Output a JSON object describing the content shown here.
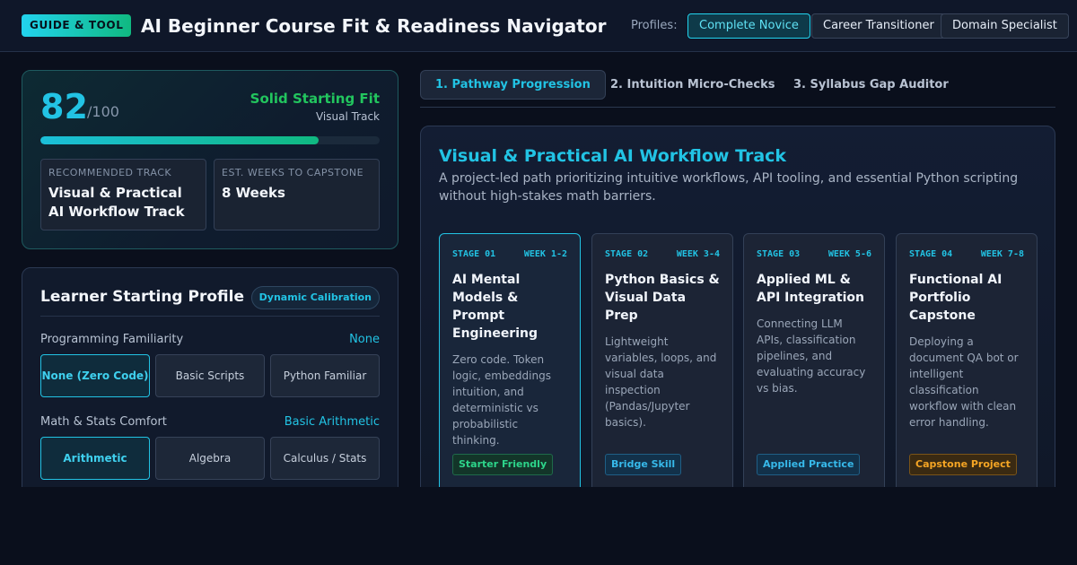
{
  "header": {
    "badge": "GUIDE & TOOL",
    "title": "AI Beginner Course Fit & Readiness Navigator",
    "profiles_label": "Profiles:",
    "profiles": [
      {
        "label": "Complete Novice",
        "active": true
      },
      {
        "label": "Career Transitioner",
        "active": false
      },
      {
        "label": "Domain Specialist",
        "active": false
      }
    ]
  },
  "score": {
    "value": "82",
    "max": "/100",
    "fit_label": "Solid Starting Fit",
    "track_sub": "Visual Track",
    "progress_percent": 82,
    "recommended_label": "RECOMMENDED TRACK",
    "recommended_value": "Visual & Practical AI Workflow Track",
    "weeks_label": "EST. WEEKS TO CAPSTONE",
    "weeks_value": "8 Weeks"
  },
  "profile": {
    "title": "Learner Starting Profile",
    "pill": "Dynamic Calibration",
    "programming": {
      "label": "Programming Familiarity",
      "value": "None",
      "options": [
        "None (Zero Code)",
        "Basic Scripts",
        "Python Familiar"
      ],
      "selected": 0
    },
    "math": {
      "label": "Math & Stats Comfort",
      "value": "Basic Arithmetic",
      "options": [
        "Arithmetic",
        "Algebra",
        "Calculus / Stats"
      ],
      "selected": 0
    }
  },
  "tabs": [
    {
      "label": "1. Pathway Progression",
      "active": true
    },
    {
      "label": "2. Intuition Micro-Checks",
      "active": false
    },
    {
      "label": "3. Syllabus Gap Auditor",
      "active": false
    }
  ],
  "track": {
    "title": "Visual & Practical AI Workflow Track",
    "description": "A project-led path prioritizing intuitive workflows, API tooling, and essential Python scripting without high-stakes math barriers.",
    "stages": [
      {
        "stage": "STAGE 01",
        "week": "WEEK 1-2",
        "title": "AI Mental Models & Prompt Engineering",
        "desc": "Zero code. Token logic, embeddings intuition, and deterministic vs probabilistic thinking.",
        "tag": "Starter Friendly",
        "tag_color": "#2dd48a"
      },
      {
        "stage": "STAGE 02",
        "week": "WEEK 3-4",
        "title": "Python Basics & Visual Data Prep",
        "desc": "Lightweight variables, loops, and visual data inspection (Pandas/Jupyter basics).",
        "tag": "Bridge Skill",
        "tag_color": "#37b9ea"
      },
      {
        "stage": "STAGE 03",
        "week": "WEEK 5-6",
        "title": "Applied ML & API Integration",
        "desc": "Connecting LLM APIs, classification pipelines, and evaluating accuracy vs bias.",
        "tag": "Applied Practice",
        "tag_color": "#37b9ea"
      },
      {
        "stage": "STAGE 04",
        "week": "WEEK 7-8",
        "title": "Functional AI Portfolio Capstone",
        "desc": "Deploying a document QA bot or intelligent classification workflow with clean error handling.",
        "tag": "Capstone Project",
        "tag_color": "#f5a524"
      }
    ]
  }
}
